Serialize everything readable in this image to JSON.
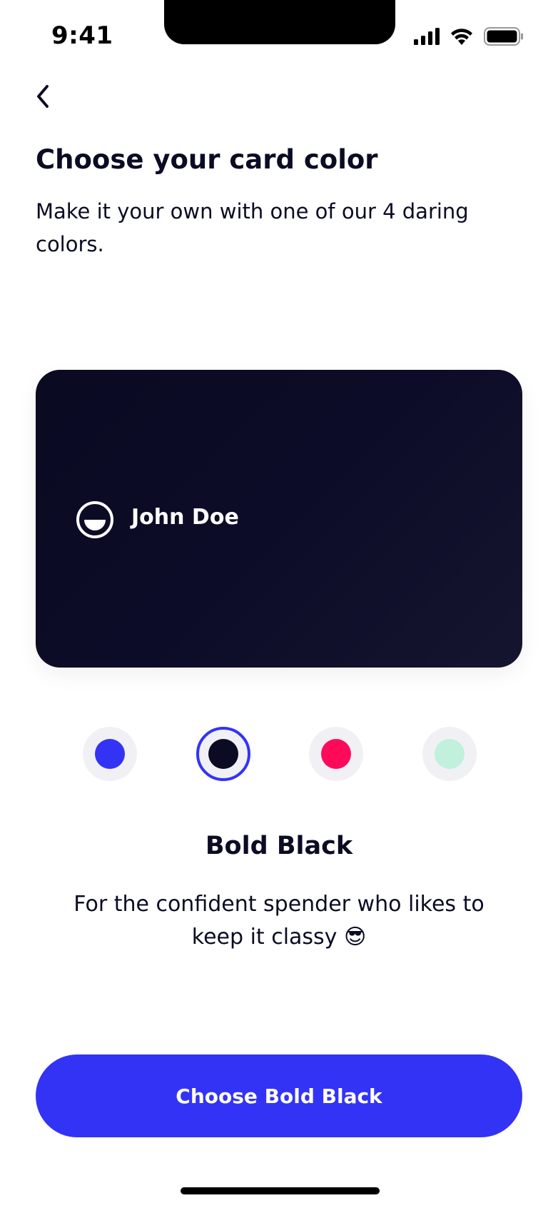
{
  "status_bar": {
    "time": "9:41"
  },
  "header": {
    "back_icon": "chevron-left-icon",
    "title": "Choose your card color",
    "subtitle": "Make it your own with one of our 4 daring colors."
  },
  "card": {
    "holder_name": "John Doe",
    "logo_icon": "smile-logo-icon",
    "color": "#0a0a22"
  },
  "swatches": [
    {
      "id": "blue",
      "color": "#3333f6",
      "selected": false
    },
    {
      "id": "black",
      "color": "#0b0b24",
      "selected": true
    },
    {
      "id": "pink",
      "color": "#ff0a5a",
      "selected": false
    },
    {
      "id": "mint",
      "color": "#c1f0dc",
      "selected": false
    }
  ],
  "selection": {
    "color_name": "Bold Black",
    "description": "For the confident spender who likes to keep it classy 😎"
  },
  "cta": {
    "label": "Choose Bold Black",
    "color": "#3333f6"
  }
}
